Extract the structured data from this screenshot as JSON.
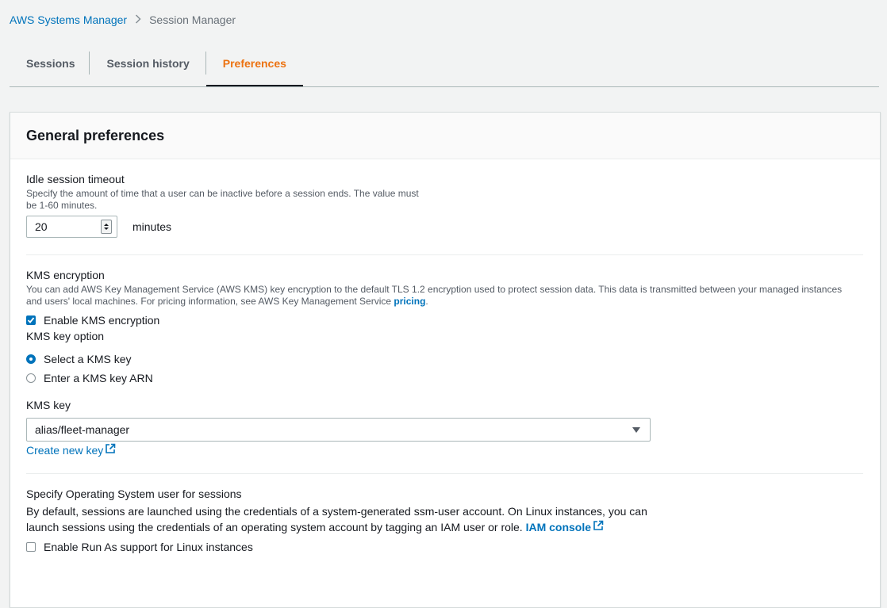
{
  "breadcrumb": {
    "root": "AWS Systems Manager",
    "current": "Session Manager"
  },
  "tabs": [
    {
      "label": "Sessions",
      "active": false
    },
    {
      "label": "Session history",
      "active": false
    },
    {
      "label": "Preferences",
      "active": true
    }
  ],
  "panel": {
    "title": "General preferences"
  },
  "idle_timeout": {
    "label": "Idle session timeout",
    "description_line1": "Specify the amount of time that a user can be inactive before a session ends. The value must",
    "description_line2": "be 1-60 minutes.",
    "value": "20",
    "unit": "minutes"
  },
  "kms": {
    "label": "KMS encryption",
    "description_line1": "You can add AWS Key Management Service (AWS KMS) key encryption to the default TLS 1.2 encryption used to protect session data. This data is transmitted between your managed instances",
    "description_line2": "and users' local machines. For pricing information, see AWS Key Management Service ",
    "pricing_link": "pricing",
    "period": ".",
    "enable_label": "Enable KMS encryption",
    "enable_checked": true,
    "key_option_label": "KMS key option",
    "option_select": "Select a KMS key",
    "option_enter_arn": "Enter a KMS key ARN",
    "selected_option": "select",
    "key_label": "KMS key",
    "key_value": "alias/fleet-manager",
    "create_key_link": "Create new key"
  },
  "run_as": {
    "label": "Specify Operating System user for sessions",
    "body_line1": "By default, sessions are launched using the credentials of a system-generated ssm-user account. On Linux instances, you can",
    "body_line2": "launch sessions using the credentials of an operating system account by tagging an IAM user or role. ",
    "iam_link": "IAM console",
    "enable_label": "Enable Run As support for Linux instances",
    "enable_checked": false
  },
  "colors": {
    "link": "#0073bb",
    "active_tab": "#ec7211",
    "text": "#16191f",
    "muted": "#545b64"
  }
}
